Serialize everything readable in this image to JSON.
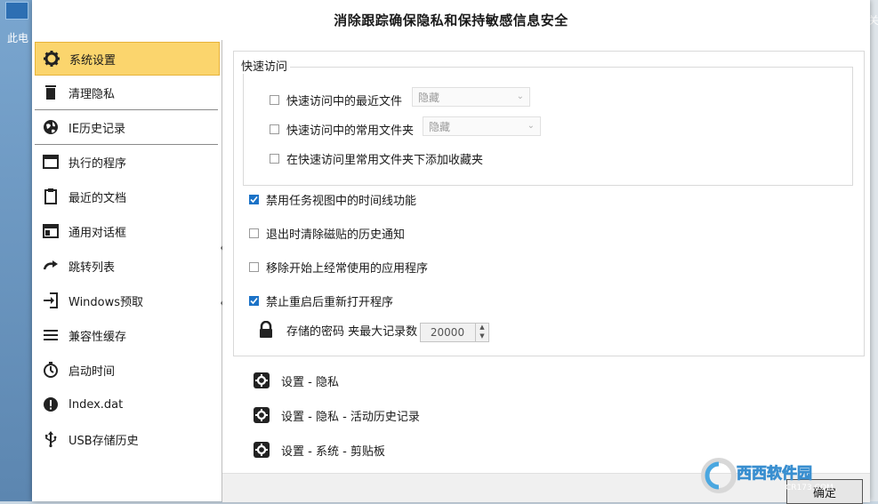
{
  "desktop": {
    "left_icon_label": "此电",
    "right_edge_label": "关"
  },
  "window": {
    "title": "消除跟踪确保隐私和保持敏感信息安全"
  },
  "sidebar": {
    "items": [
      {
        "label": "系统设置",
        "icon": "gear-icon"
      },
      {
        "label": "清理隐私",
        "icon": "trash-icon"
      },
      {
        "label": "IE历史记录",
        "icon": "globe-icon"
      },
      {
        "label": "执行的程序",
        "icon": "window-icon"
      },
      {
        "label": "最近的文档",
        "icon": "clipboard-icon"
      },
      {
        "label": "通用对话框",
        "icon": "dialog-icon"
      },
      {
        "label": "跳转列表",
        "icon": "redo-arrow-icon"
      },
      {
        "label": "Windows预取",
        "icon": "enter-icon"
      },
      {
        "label": "兼容性缓存",
        "icon": "list-icon"
      },
      {
        "label": "启动时间",
        "icon": "stopwatch-icon"
      },
      {
        "label": "Index.dat",
        "icon": "alert-icon"
      },
      {
        "label": "USB存储历史",
        "icon": "usb-icon"
      }
    ]
  },
  "quick_access": {
    "legend": "快速访问",
    "recent_files": {
      "label": "快速访问中的最近文件",
      "value": "隐藏"
    },
    "frequent_folders": {
      "label": "快速访问中的常用文件夹",
      "value": "隐藏"
    },
    "add_favorites": {
      "label": "在快速访问里常用文件夹下添加收藏夹"
    }
  },
  "options": {
    "disable_timeline": {
      "label": "禁用任务视图中的时间线功能",
      "checked": true
    },
    "clear_tile_history": {
      "label": "退出时清除磁贴的历史通知",
      "checked": false
    },
    "remove_frequent_apps": {
      "label": "移除开始上经常使用的应用程序",
      "checked": false
    },
    "no_reopen": {
      "label": "禁止重启后重新打开程序",
      "checked": true
    }
  },
  "password_store": {
    "label": "存储的密码 夹最大记录数",
    "value": "20000"
  },
  "links": {
    "privacy": "设置 - 隐私",
    "activity": "设置 - 隐私 - 活动历史记录",
    "clipboard": "设置 - 系统 - 剪贴板"
  },
  "ok_button": "确定",
  "watermark": {
    "brand": "西西软件园",
    "url": "CR173.COM"
  },
  "colors": {
    "active_item": "#fbd56d",
    "checkbox": "#1b72c7"
  }
}
